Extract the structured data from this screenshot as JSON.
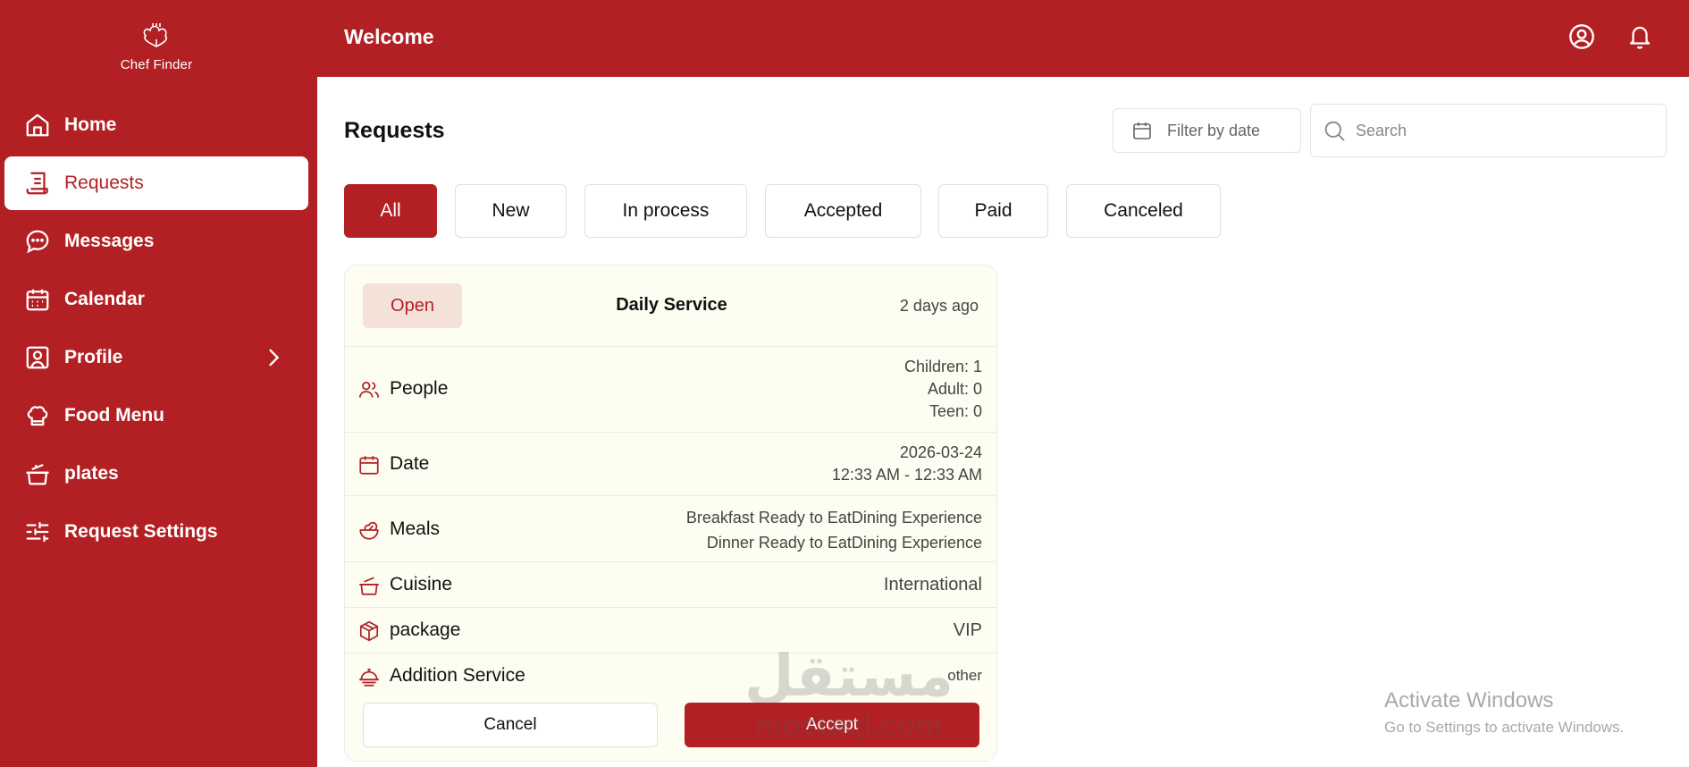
{
  "app": {
    "brand": "Chef Finder",
    "welcome": "Welcome"
  },
  "colors": {
    "brand_red": "#b32024",
    "card_bg": "#fdfdf1",
    "badge_bg": "#f4e2d8"
  },
  "sidebar": {
    "items": [
      {
        "label": "Home",
        "icon": "home-icon"
      },
      {
        "label": "Requests",
        "icon": "receipt-icon",
        "active": true
      },
      {
        "label": "Messages",
        "icon": "chat-icon"
      },
      {
        "label": "Calendar",
        "icon": "calendar-icon"
      },
      {
        "label": "Profile",
        "icon": "user-square-icon",
        "has_submenu": true
      },
      {
        "label": "Food Menu",
        "icon": "chef-hat-icon"
      },
      {
        "label": "plates",
        "icon": "cooking-pot-icon"
      },
      {
        "label": "Request Settings",
        "icon": "sliders-icon"
      }
    ]
  },
  "header": {
    "icons": [
      "user-circle-icon",
      "bell-icon"
    ]
  },
  "main": {
    "title": "Requests",
    "filter_date_label": "Filter by date",
    "search_placeholder": "Search",
    "tabs": [
      {
        "label": "All",
        "active": true
      },
      {
        "label": "New"
      },
      {
        "label": "In process"
      },
      {
        "label": "Accepted"
      },
      {
        "label": "Paid"
      },
      {
        "label": "Canceled"
      }
    ]
  },
  "request_card": {
    "status": "Open",
    "service": "Daily Service",
    "time_ago": "2 days ago",
    "rows": [
      {
        "label": "People",
        "icon": "users-icon",
        "values": [
          "Children: 1",
          "Adult: 0",
          "Teen: 0"
        ]
      },
      {
        "label": "Date",
        "icon": "calendar-icon",
        "values": [
          "2026-03-24",
          "12:33 AM - 12:33 AM"
        ]
      },
      {
        "label": "Meals",
        "icon": "salad-bowl-icon",
        "values": [
          "Breakfast Ready to EatDining Experience",
          "Dinner Ready to EatDining Experience"
        ]
      },
      {
        "label": "Cuisine",
        "icon": "cooking-pot-icon",
        "values": [
          "International"
        ]
      },
      {
        "label": "package",
        "icon": "package-icon",
        "values": [
          "VIP"
        ]
      },
      {
        "label": "Addition Service",
        "icon": "dish-icon",
        "values": [
          "other"
        ]
      }
    ],
    "cancel_label": "Cancel",
    "accept_label": "Accept"
  },
  "watermark": {
    "arabic": "مستقل",
    "latin": "mostaql.com"
  },
  "os_notice": {
    "title": "Activate Windows",
    "subtitle": "Go to Settings to activate Windows."
  }
}
